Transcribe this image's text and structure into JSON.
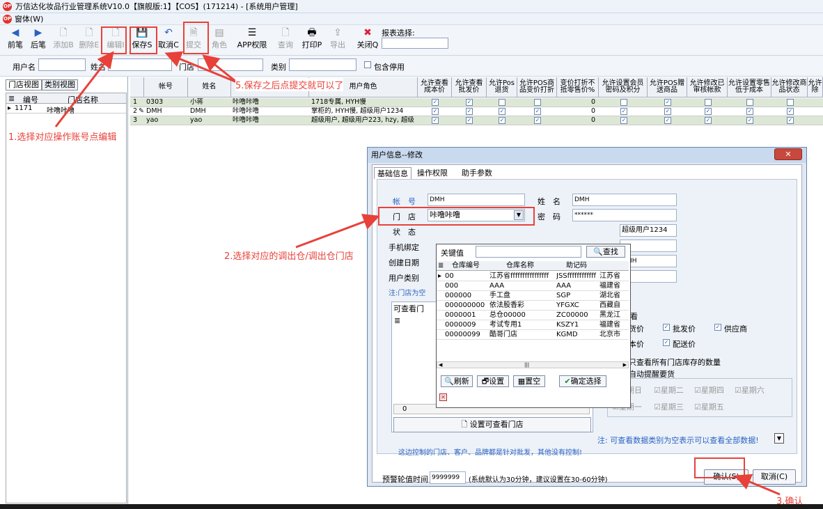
{
  "window": {
    "title": "万信达化妆品行业管理系统V10.0【旗舰版:1】【COS】(171214) - [系统用户管理]"
  },
  "menu": {
    "item": "窗体(W)"
  },
  "toolbar": {
    "prev": "前笔",
    "next": "后笔",
    "add": "添加B",
    "delete": "删除E",
    "edit": "编辑I",
    "save": "保存S",
    "cancel": "取消C",
    "submit": "提交",
    "role": "角色",
    "app_perm": "APP权限",
    "query": "查询",
    "print": "打印P",
    "export": "导出",
    "close": "关闭Q",
    "report_label": "报表选择:"
  },
  "filter": {
    "username": "用户名",
    "name": "姓名",
    "store": "门店",
    "category": "类别",
    "include_disabled": "包含停用"
  },
  "left": {
    "tab_store": "门店视图",
    "tab_category": "类别视图",
    "col_code": "编号",
    "col_name": "门店名称",
    "rows": [
      {
        "code": "1171",
        "name": "咔噜咔噜"
      }
    ]
  },
  "grid": {
    "headers": {
      "account": "帐号",
      "name": "姓名",
      "store": "门店",
      "role": "用户角色",
      "c1": "允许查看成本价",
      "c2": "允许查看批发价",
      "c3": "允许Pos退货",
      "c4": "允许POS商品变价打折",
      "c5": "变价打折不抵零售价%",
      "c6": "允许设置会员密码及积分",
      "c7": "允许POS赠送商品",
      "c8": "允许修改已审核帐款",
      "c9": "允许设置零售低于成本",
      "c10": "允许修改商品状态",
      "c11": "允许除"
    },
    "rows": [
      {
        "no": "1",
        "account": "0303",
        "name": "小蒋",
        "store": "咔噜咔噜",
        "role": "1718专属, HYH慢",
        "pct": "0"
      },
      {
        "no": "2",
        "account": "DMH",
        "name": "DMH",
        "store": "咔噜咔噜",
        "role": "掌柜的, HYH慢, 超级用户1234",
        "pct": "0"
      },
      {
        "no": "3",
        "account": "yao",
        "name": "yao",
        "store": "咔噜咔噜",
        "role": "超级用户, 超级用户223, hzy, 超级",
        "pct": "0"
      }
    ]
  },
  "annotations": {
    "a1": "1.选择对应操作账号点编辑",
    "a2": "2.选择对应的调出仓/调出仓门店",
    "a3": "3.确认",
    "a5": "5.保存之后点提交就可以了"
  },
  "dialog": {
    "title": "用户信息--修改",
    "tab_basic": "基础信息",
    "tab_perm": "操作权限",
    "tab_assist": "助手参数",
    "account_label": "帐　号",
    "account_value": "DMH",
    "name_label": "姓　名",
    "name_value": "DMH",
    "store_label": "门　店",
    "store_value": "咔噜咔噜",
    "password_label": "密　码",
    "password_value": "******",
    "status_label": "状　态",
    "phone_label": "手机绑定",
    "created_label": "创建日期",
    "usertype_label": "用户类别",
    "note_store": "注:门店为空",
    "role_value": "超级用户1234",
    "creator_value": "DMH",
    "view_stores_tab": "可查看门",
    "list_count": "0",
    "set_stores_btn": "设置可查看门店",
    "footer_note": "这边控制的门店、客户、品牌都是针对批发，其他没有控制!",
    "view_title": "查看",
    "perm_purchase": "进货价",
    "perm_wholesale": "批发价",
    "perm_supplier": "供应商",
    "perm_cost": "成本价",
    "perm_delivery": "配送价",
    "stock_text": "许只查看所有门店库存的数量",
    "remind_text": "否自动提醒要货",
    "weekdays": [
      "星期日",
      "星期二",
      "星期四",
      "星期六",
      "星期一",
      "星期三",
      "星期五"
    ],
    "empty_note": "注: 可查看数据类别为空表示可以查看全部数据!",
    "alert_label": "预警轮值时间",
    "alert_value": "9999999",
    "alert_note": "(系统默认为30分钟，建议设置在30-60分钟)",
    "confirm": "确认(S)",
    "cancel": "取消(C)"
  },
  "popup": {
    "keyword_label": "关键值",
    "search_btn": "查找",
    "col_code": "仓库编号",
    "col_name": "仓库名称",
    "col_memo": "助记码",
    "rows": [
      {
        "code": "00",
        "name": "江苏省ffffffffffffffff",
        "memo": "JSSffffffffffff",
        "extra": "江苏省"
      },
      {
        "code": "000",
        "name": "AAA",
        "memo": "AAA",
        "extra": "福建省"
      },
      {
        "code": "000000",
        "name": "手工盘",
        "memo": "SGP",
        "extra": "湖北省"
      },
      {
        "code": "000000000",
        "name": "依法股香彩",
        "memo": "YFGXC",
        "extra": "西藏自"
      },
      {
        "code": "0000001",
        "name": "总仓00000",
        "memo": "ZC00000",
        "extra": "黑龙江"
      },
      {
        "code": "0000009",
        "name": "考试专用1",
        "memo": "KSZY1",
        "extra": "福建省"
      },
      {
        "code": "00000099",
        "name": "酷哥门店",
        "memo": "KGMD",
        "extra": "北京市"
      }
    ],
    "refresh": "刷新",
    "settings": "设置",
    "clear": "置空",
    "confirm_select": "确定选择"
  }
}
